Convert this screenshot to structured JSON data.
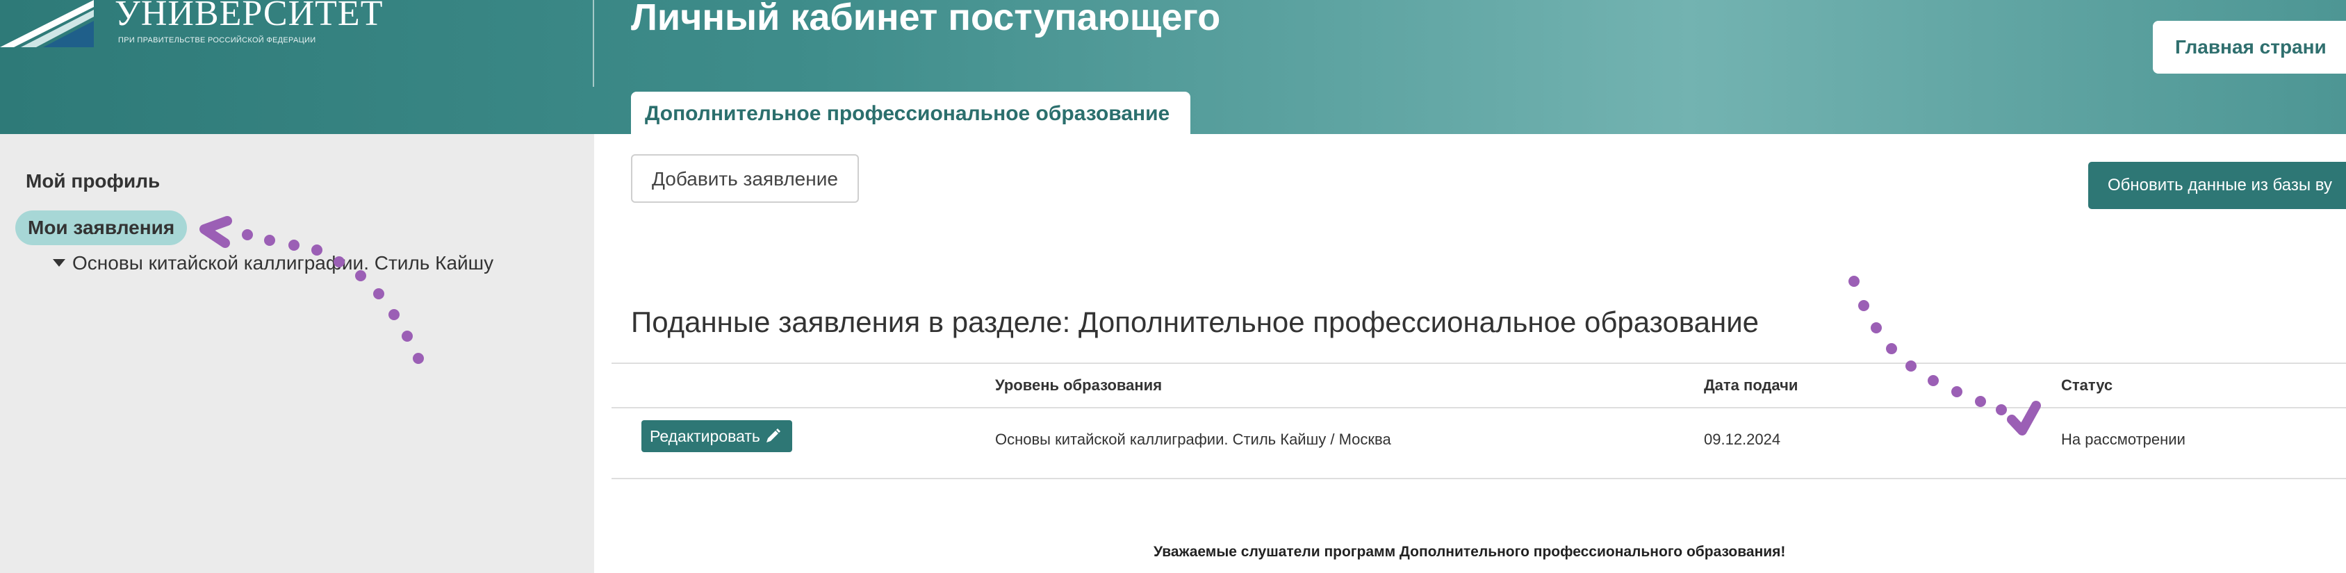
{
  "header": {
    "logo_title": "УНИВЕРСИТЕТ",
    "logo_subtitle": "ПРИ ПРАВИТЕЛЬСТВЕ РОССИЙСКОЙ ФЕДЕРАЦИИ",
    "page_title": "Личный кабинет поступающего",
    "home_button": "Главная страни",
    "active_tab": "Дополнительное профессиональное образование"
  },
  "sidebar": {
    "profile": "Мой профиль",
    "applications": "Мои заявления",
    "application_item": "Основы китайской каллиграфии. Стиль Кайшу"
  },
  "main": {
    "add_button": "Добавить заявление",
    "refresh_button": "Обновить данные из базы ву",
    "section_heading": "Поданные заявления в разделе: Дополнительное профессиональное образование",
    "table": {
      "headers": {
        "level": "Уровень образования",
        "date": "Дата подачи",
        "status": "Статус"
      },
      "rows": [
        {
          "edit_label": "Редактировать",
          "level": "Основы китайской каллиграфии. Стиль Кайшу / Москва",
          "date": "09.12.2024",
          "status": "На рассмотрении"
        }
      ]
    },
    "notice": "Уважаемые слушатели программ Дополнительного профессионального образования!"
  },
  "icons": {
    "logo": "university-logo-mark",
    "caret": "caret-down-icon",
    "edit": "pencil-icon"
  },
  "colors": {
    "header_teal": "#3f8d8b",
    "button_teal": "#2e7775",
    "pill_highlight": "#a7d7d6",
    "sidebar_bg": "#ebebeb",
    "annotation_purple": "#9b5fb5"
  }
}
